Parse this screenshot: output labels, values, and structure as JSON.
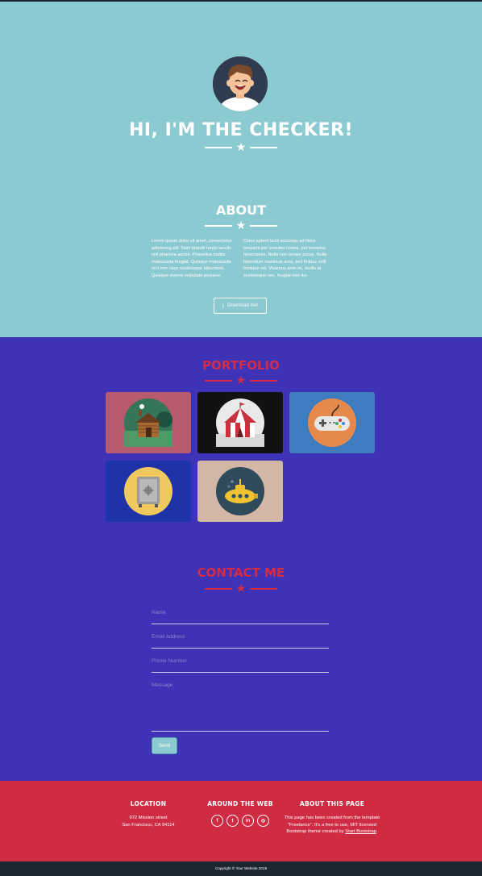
{
  "hero": {
    "title": "HI, I'M THE CHECKER!"
  },
  "about": {
    "title": "ABOUT",
    "left_text": "Lorem ipsum dolor sit amet, consectetur adipiscing elit. Nam blandit turpis iaculis nisl pharetra auctor. Phasellus mattis malesuada feugiat. Quisque malesuada orci non risus scelerisque bibendum. Quisque viverra vulputate posuere.",
    "right_text": "Class aptent taciti sociosqu ad litora torquent per conubia nostra, per inceptos himenaeos. Nulla non ornare purus. Nulla bibendum maximus urna, sed finibus velit tristique vel. Vivamus ante mi, mollis at scelerisque nec, feugiat non dui.",
    "download_label": "Download me!"
  },
  "portfolio": {
    "title": "PORTFOLIO",
    "items": [
      {
        "icon": "cabin-icon",
        "bg": "#b85a6d"
      },
      {
        "icon": "circus-tent-icon",
        "bg": "#111111"
      },
      {
        "icon": "gamepad-icon",
        "bg": "#3f7dc1"
      },
      {
        "icon": "safe-icon",
        "bg": "#1f33a8"
      },
      {
        "icon": "submarine-icon",
        "bg": "#d2b6a6"
      }
    ]
  },
  "contact": {
    "title": "CONTACT ME",
    "name_placeholder": "Name",
    "email_placeholder": "Email Address",
    "phone_placeholder": "Phone Number",
    "message_placeholder": "Message",
    "send_label": "Send"
  },
  "footer": {
    "location": {
      "title": "LOCATION",
      "line1": "972 Mission street",
      "line2": "San Francisco, CA 94114"
    },
    "web": {
      "title": "AROUND THE WEB",
      "icons": [
        "facebook-icon",
        "twitter-icon",
        "linkedin-icon",
        "dribbble-icon"
      ],
      "glyphs": [
        "f",
        "t",
        "in",
        "◎"
      ]
    },
    "about_page": {
      "title": "ABOUT THIS PAGE",
      "text": "This page has been created from the template \"Freelance\". It's a free to use, MIT licensed Bootstrap theme created by",
      "link": "Start Bootstrap",
      "after": "."
    },
    "copyright": "Copyright © Your Website 2019"
  },
  "colors": {
    "teal": "#8ccad1",
    "purple": "#3e32b6",
    "red": "#cf2b43",
    "dark": "#1b2631"
  }
}
